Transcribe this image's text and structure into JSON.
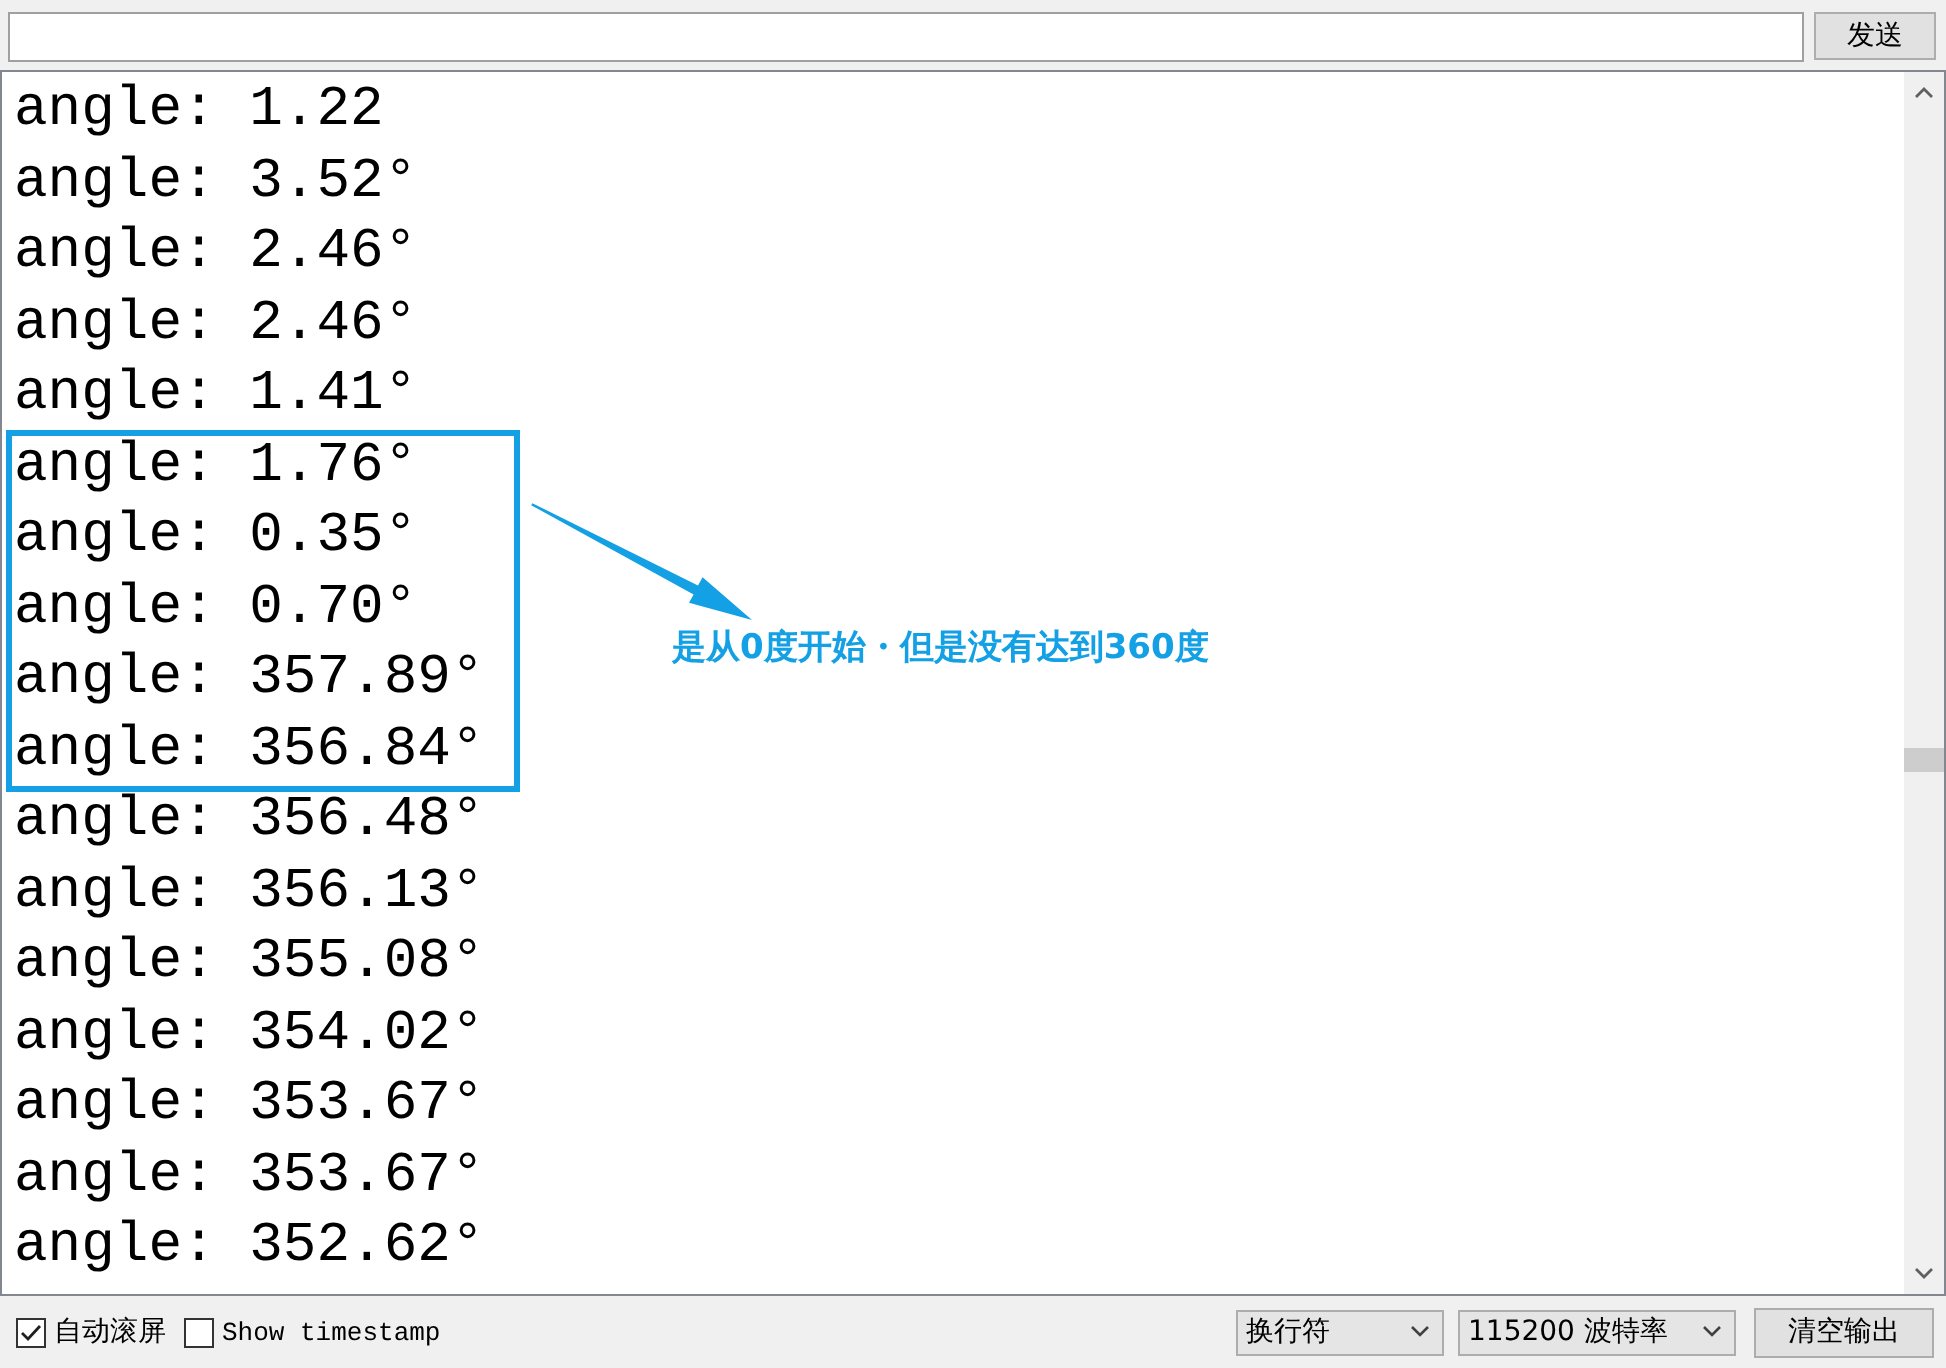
{
  "send_bar": {
    "button": "发送"
  },
  "output": {
    "lines": [
      {
        "text": "angle: 1.22",
        "highlighted": false
      },
      {
        "text": "angle: 3.52°",
        "highlighted": false
      },
      {
        "text": "angle: 2.46°",
        "highlighted": false
      },
      {
        "text": "angle: 2.46°",
        "highlighted": false
      },
      {
        "text": "angle: 1.41°",
        "highlighted": false
      },
      {
        "text": "angle: 1.76°",
        "highlighted": true
      },
      {
        "text": "angle: 0.35°",
        "highlighted": true
      },
      {
        "text": "angle: 0.70°",
        "highlighted": true
      },
      {
        "text": "angle: 357.89°",
        "highlighted": true
      },
      {
        "text": "angle: 356.84°",
        "highlighted": true
      },
      {
        "text": "angle: 356.48°",
        "highlighted": false
      },
      {
        "text": "angle: 356.13°",
        "highlighted": false
      },
      {
        "text": "angle: 355.08°",
        "highlighted": false
      },
      {
        "text": "angle: 354.02°",
        "highlighted": false
      },
      {
        "text": "angle: 353.67°",
        "highlighted": false
      },
      {
        "text": "angle: 353.67°",
        "highlighted": false
      },
      {
        "text": "angle: 352.62°",
        "highlighted": false
      }
    ]
  },
  "annotation": {
    "text": "是从0度开始・但是没有达到360度"
  },
  "footer": {
    "checkboxes": [
      {
        "label": "自动滚屏",
        "checked": true,
        "kind": "cjk"
      },
      {
        "label": "Show timestamp",
        "checked": false,
        "kind": "mono"
      }
    ],
    "dropdowns": [
      {
        "value": "换行符"
      },
      {
        "value": "115200 波特率"
      }
    ],
    "button": "清空输出"
  }
}
